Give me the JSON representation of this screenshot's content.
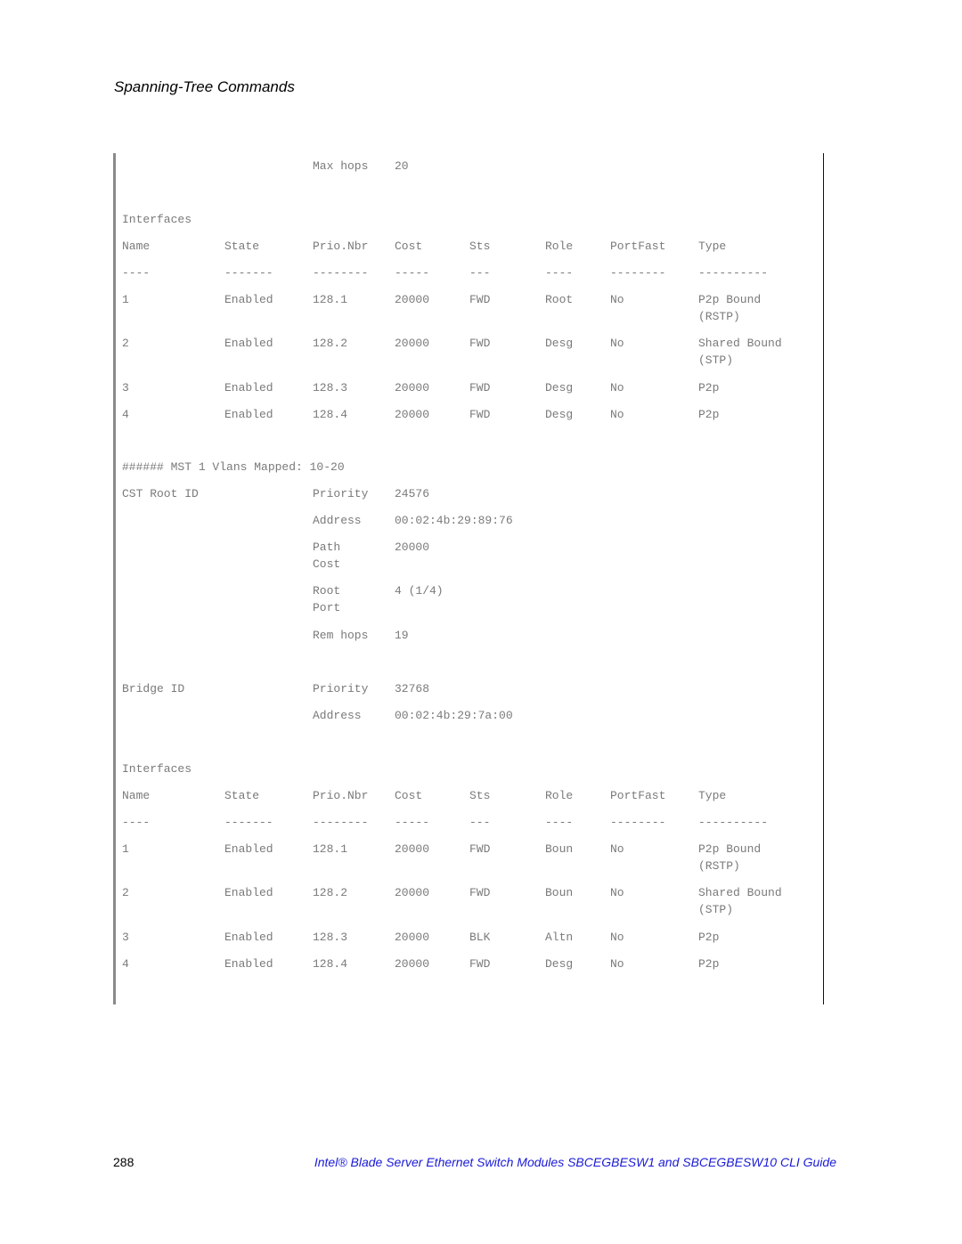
{
  "header": {
    "section_title": "Spanning-Tree Commands"
  },
  "cst": {
    "max_hops_label": "Max hops",
    "max_hops_value": "20"
  },
  "table1": {
    "label": "Interfaces",
    "columns": [
      "Name",
      "State",
      "Prio.Nbr",
      "Cost",
      "Sts",
      "Role",
      "PortFast",
      "Type"
    ],
    "separators": [
      "----",
      "-------",
      "--------",
      "-----",
      "---",
      "----",
      "--------",
      "----------"
    ],
    "rows": [
      {
        "name": "1",
        "state": "Enabled",
        "prio": "128.1",
        "cost": "20000",
        "sts": "FWD",
        "role": "Root",
        "portfast": "No",
        "type": "P2p Bound",
        "type2": "(RSTP)"
      },
      {
        "name": "2",
        "state": "Enabled",
        "prio": "128.2",
        "cost": "20000",
        "sts": "FWD",
        "role": "Desg",
        "portfast": "No",
        "type": "Shared Bound",
        "type2": "(STP)"
      },
      {
        "name": "3",
        "state": "Enabled",
        "prio": "128.3",
        "cost": "20000",
        "sts": "FWD",
        "role": "Desg",
        "portfast": "No",
        "type": "P2p",
        "type2": ""
      },
      {
        "name": "4",
        "state": "Enabled",
        "prio": "128.4",
        "cost": "20000",
        "sts": "FWD",
        "role": "Desg",
        "portfast": "No",
        "type": "P2p",
        "type2": ""
      }
    ]
  },
  "mst1": {
    "heading": "###### MST 1 Vlans Mapped: 10-20",
    "cst_root_label": "CST Root ID",
    "priority_label": "Priority",
    "priority_value": "24576",
    "address_label": "Address",
    "address_value": "00:02:4b:29:89:76",
    "path_label_1": "Path",
    "path_label_2": "Cost",
    "path_value": "20000",
    "root_port_label_1": "Root",
    "root_port_label_2": "Port",
    "root_port_value": "4 (1/4)",
    "rem_hops_label": "Rem hops",
    "rem_hops_value": "19",
    "bridge_label": "Bridge ID",
    "bridge_priority_label": "Priority",
    "bridge_priority_value": "32768",
    "bridge_address_label": "Address",
    "bridge_address_value": "00:02:4b:29:7a:00"
  },
  "table2": {
    "label": "Interfaces",
    "columns": [
      "Name",
      "State",
      "Prio.Nbr",
      "Cost",
      "Sts",
      "Role",
      "PortFast",
      "Type"
    ],
    "separators": [
      "----",
      "-------",
      "--------",
      "-----",
      "---",
      "----",
      "--------",
      "----------"
    ],
    "rows": [
      {
        "name": "1",
        "state": "Enabled",
        "prio": "128.1",
        "cost": "20000",
        "sts": "FWD",
        "role": "Boun",
        "portfast": "No",
        "type": "P2p Bound",
        "type2": "(RSTP)"
      },
      {
        "name": "2",
        "state": "Enabled",
        "prio": "128.2",
        "cost": "20000",
        "sts": "FWD",
        "role": "Boun",
        "portfast": "No",
        "type": "Shared Bound",
        "type2": "(STP)"
      },
      {
        "name": "3",
        "state": "Enabled",
        "prio": "128.3",
        "cost": "20000",
        "sts": "BLK",
        "role": "Altn",
        "portfast": "No",
        "type": "P2p",
        "type2": ""
      },
      {
        "name": "4",
        "state": "Enabled",
        "prio": "128.4",
        "cost": "20000",
        "sts": "FWD",
        "role": "Desg",
        "portfast": "No",
        "type": "P2p",
        "type2": ""
      }
    ]
  },
  "footer": {
    "page_number": "288",
    "doc_title": "Intel® Blade Server Ethernet Switch Modules SBCEGBESW1 and SBCEGBESW10 CLI Guide"
  },
  "colors": {
    "footer_title": "#1a1ad6",
    "code_text": "#7a7a7a"
  }
}
